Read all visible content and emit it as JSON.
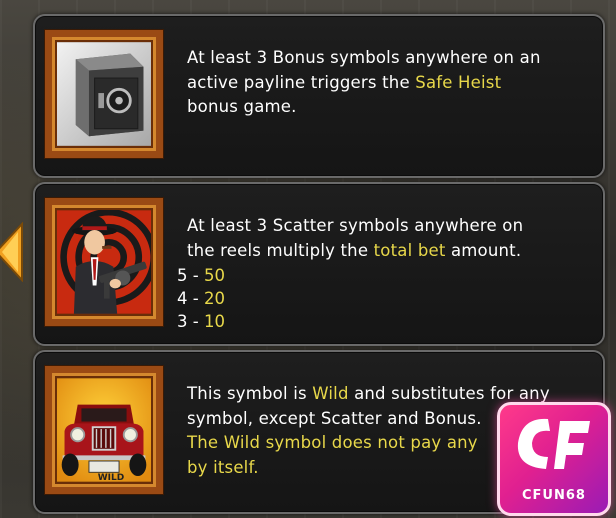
{
  "panels": {
    "bonus": {
      "line1": "At least 3 Bonus symbols anywhere on an",
      "line2_pre": "active payline triggers the ",
      "line2_hl": "Safe Heist",
      "line3": "bonus game.",
      "icon": "safe-icon"
    },
    "scatter": {
      "line1": "At least 3 Scatter symbols anywhere on",
      "line2_pre": "the reels multiply the ",
      "line2_hl": "total bet",
      "line2_post": " amount.",
      "icon": "gangster-icon",
      "pays": [
        {
          "count": "5",
          "sep": " - ",
          "value": "50"
        },
        {
          "count": "4",
          "sep": " - ",
          "value": "20"
        },
        {
          "count": "3",
          "sep": " - ",
          "value": "10"
        }
      ]
    },
    "wild": {
      "line1_pre": "This symbol is ",
      "line1_hl": "Wild",
      "line1_post": " and substitutes for any",
      "line2": "symbol, except Scatter and Bonus.",
      "line3_hl": "The Wild symbol does not pay any",
      "line4_hl": "by itself.",
      "icon": "vintage-car-icon",
      "plate": "WILD"
    }
  },
  "watermark": {
    "label": "CFUN68",
    "icon": "cf-logo-icon"
  },
  "colors": {
    "highlight": "#e8d84a",
    "text": "#ffffff",
    "panel_border": "#6a6a6a",
    "frame": "#9a4a14",
    "logo_pink": "#e02090"
  }
}
